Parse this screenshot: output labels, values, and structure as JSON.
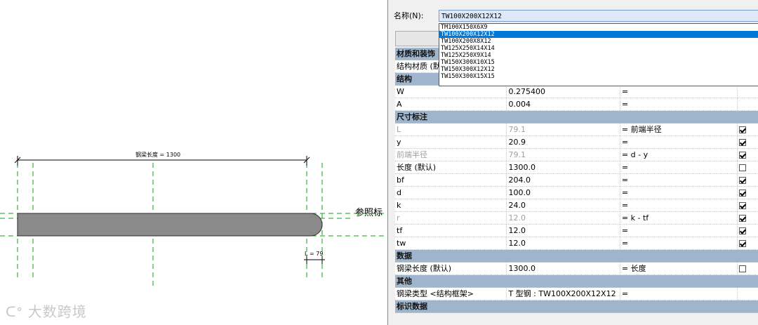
{
  "drawing": {
    "dimension_label": "钢梁长度 = 1300",
    "reference_label": "参照标",
    "l_label": "L = 79",
    "watermark": "大数跨境"
  },
  "panel": {
    "name_label": "名称(N):",
    "name_value": "TW100X200X12X12",
    "dropdown_options": [
      "TM100X150X6X9",
      "TW100X200X12X12",
      "TW100X200X8X12",
      "TW125X250X14X14",
      "TW125X250X9X14",
      "TW150X300X10X15",
      "TW150X300X12X12",
      "TW150X300X15X15"
    ],
    "selected_option": "TW100X200X12X12",
    "sections": {
      "material": {
        "title": "材质和装饰",
        "rows": [
          {
            "name": "结构材质 (默",
            "value": "",
            "formula": "",
            "checkbox": null
          }
        ]
      },
      "structure": {
        "title": "结构",
        "rows": [
          {
            "name": "W",
            "value": "0.275400",
            "formula": "=",
            "checkbox": null
          },
          {
            "name": "A",
            "value": "0.004",
            "formula": "=",
            "checkbox": null
          }
        ]
      },
      "dimensions": {
        "title": "尺寸标注",
        "rows": [
          {
            "name": "L",
            "value": "79.1",
            "formula": "= 前端半径",
            "checkbox": true,
            "dim": true
          },
          {
            "name": "y",
            "value": "20.9",
            "formula": "=",
            "checkbox": true,
            "dim": false
          },
          {
            "name": "前端半径",
            "value": "79.1",
            "formula": "= d - y",
            "checkbox": true,
            "dim": true
          },
          {
            "name": "长度 (默认)",
            "value": "1300.0",
            "formula": "=",
            "checkbox": false,
            "dim": false
          },
          {
            "name": "bf",
            "value": "204.0",
            "formula": "=",
            "checkbox": true,
            "dim": false
          },
          {
            "name": "d",
            "value": "100.0",
            "formula": "=",
            "checkbox": true,
            "dim": false
          },
          {
            "name": "k",
            "value": "24.0",
            "formula": "=",
            "checkbox": true,
            "dim": false
          },
          {
            "name": "r",
            "value": "12.0",
            "formula": "= k - tf",
            "checkbox": true,
            "dim": true
          },
          {
            "name": "tf",
            "value": "12.0",
            "formula": "=",
            "checkbox": true,
            "dim": false
          },
          {
            "name": "tw",
            "value": "12.0",
            "formula": "=",
            "checkbox": true,
            "dim": false
          }
        ]
      },
      "data": {
        "title": "数据",
        "rows": [
          {
            "name": "钢梁长度 (默认)",
            "value": "1300.0",
            "formula": "= 长度",
            "checkbox": false
          }
        ]
      },
      "other": {
        "title": "其他",
        "rows": [
          {
            "name": "钢梁类型 <结构框架>",
            "value": "T 型钢 : TW100X200X12X12",
            "formula": "=",
            "checkbox": null
          }
        ]
      },
      "more": {
        "title": "标识数据"
      }
    }
  }
}
